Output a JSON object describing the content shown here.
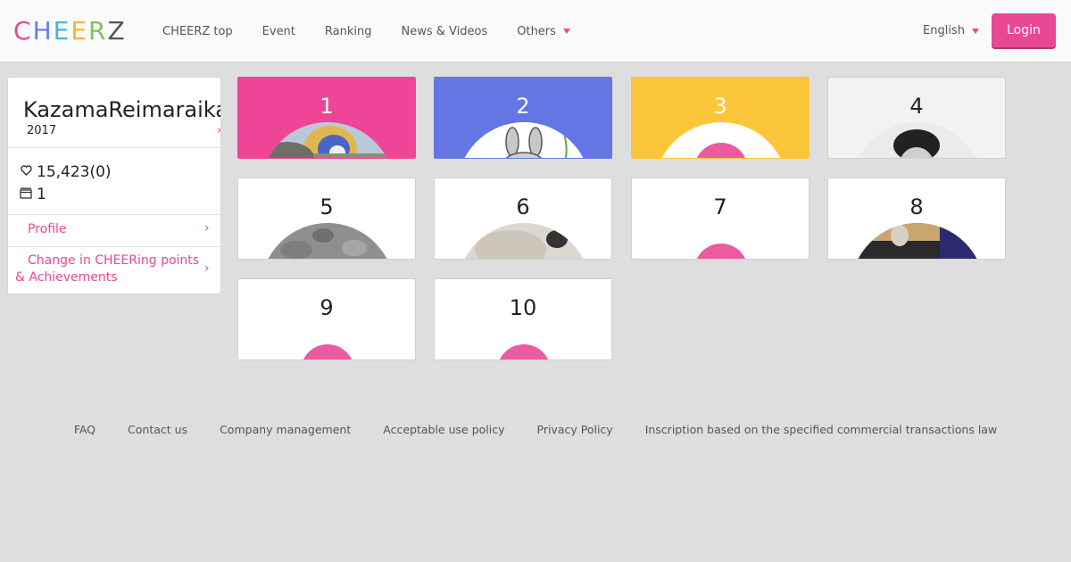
{
  "header": {
    "logo": {
      "letters": [
        "C",
        "H",
        "E",
        "E",
        "R",
        "Z"
      ],
      "colors": [
        "#e84795",
        "#6a7fe6",
        "#44b8d8",
        "#f2b53a",
        "#7cc256",
        "#555555"
      ]
    },
    "nav": [
      "CHEERZ top",
      "Event",
      "Ranking",
      "News & Videos",
      "Others"
    ],
    "nav_dropdown_icon": "caret-down-icon",
    "language": "English",
    "login_label": "Login"
  },
  "sidebar": {
    "name": "KazamaReimaraika",
    "year": "2017",
    "cheers": "15,423(0)",
    "cheers_icon": "heart-outline-icon",
    "items_count": "1",
    "items_icon": "box-icon",
    "profile_label": "Profile",
    "points_label": "Change in CHEERing points & Achievements",
    "chevron": "›"
  },
  "cards": [
    {
      "rank": "1",
      "bg": "#ee4596",
      "image": "photo-bird"
    },
    {
      "rank": "2",
      "bg": "#6476e4",
      "image": "illustration-rabbit"
    },
    {
      "rank": "3",
      "bg": "#fcc63a",
      "image": "default-avatar"
    },
    {
      "rank": "4",
      "bg": "#f2f2f2",
      "image": "photo-man"
    },
    {
      "rank": "5",
      "bg": "#ffffff",
      "image": "photo-moon"
    },
    {
      "rank": "6",
      "bg": "#ffffff",
      "image": "photo-fluffy"
    },
    {
      "rank": "7",
      "bg": "#ffffff",
      "image": "default-dot"
    },
    {
      "rank": "8",
      "bg": "#ffffff",
      "image": "photo-dinner"
    },
    {
      "rank": "9",
      "bg": "#ffffff",
      "image": "default-dot"
    },
    {
      "rank": "10",
      "bg": "#ffffff",
      "image": "default-dot"
    }
  ],
  "footer": [
    "FAQ",
    "Contact us",
    "Company management",
    "Acceptable use policy",
    "Privacy Policy",
    "Inscription based on the specified commercial transactions law"
  ],
  "colors": {
    "accent": "#e84795"
  }
}
